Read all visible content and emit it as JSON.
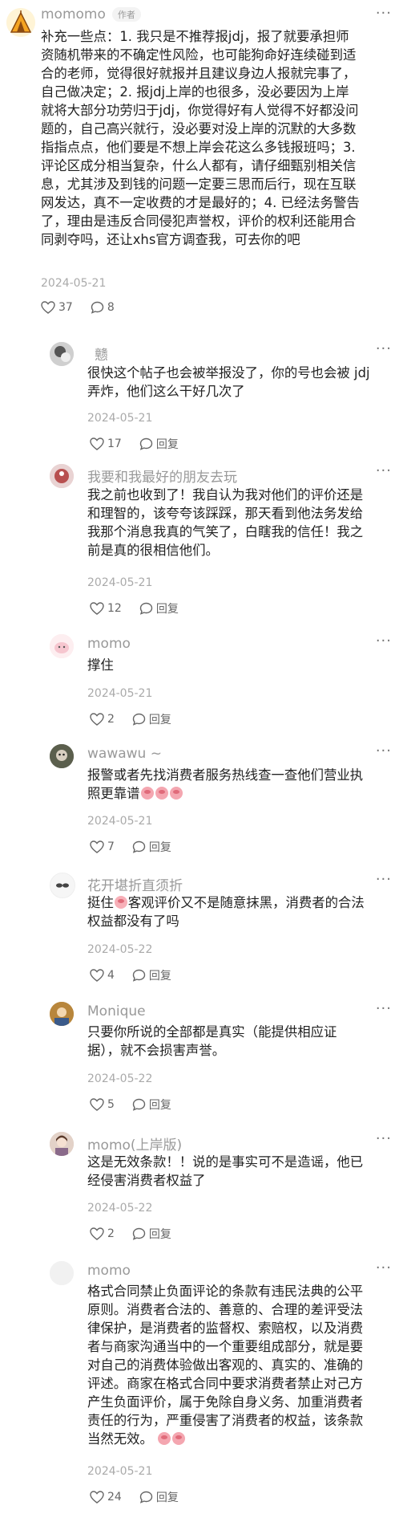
{
  "main_comment": {
    "author": "momomo",
    "author_tag": "作者",
    "lines": [
      "补充一些点：1. 我只是不推荐报jdj，报了就要承担师",
      "资随机带来的不确定性风险，也可能狗命好连续碰到适",
      "合的老师，觉得很好就报并且建议身边人报就完事了，",
      "自己做决定；2. 报jdj上岸的也很多，没必要因为上岸",
      "就将大部分功劳归于jdj，你觉得好有人觉得不好都没问",
      "题的，自己高兴就行，没必要对没上岸的沉默的大多数",
      "指指点点，他们要是不想上岸会花这么多钱报班吗；3.",
      "评论区成分相当复杂，什么人都有，请仔细甄别相关信",
      "息，尤其涉及到钱的问题一定要三思而后行，现在互联",
      "网发达，真不一定收费的才是最好的；4. 已经法务警告",
      "了，理由是违反合同侵犯声誉权，评价的权利还能用合",
      "同剥夺吗，还让xhs官方调查我，可去你的吧"
    ],
    "date": "2024-05-21",
    "likes": "37",
    "replies": "8"
  },
  "replies": [
    {
      "author": "戆",
      "lines": [
        "很快这个帖子也会被举报没了，你的号也会被 jdj",
        "弄炸，他们这么干好几次了"
      ],
      "date": "2024-05-21",
      "likes": "17",
      "reply_label": "回复"
    },
    {
      "author": "我要和我最好的朋友去玩",
      "lines": [
        "我之前也收到了！我自认为我对他们的评价还是",
        "和理智的，该夸夸该踩踩，那天看到他法务发给",
        "我那个消息我真的气笑了，白瞎我的信任！我之",
        "前是真的很相信他们。"
      ],
      "date": "2024-05-21",
      "likes": "12",
      "reply_label": "回复"
    },
    {
      "author": "momo",
      "lines": [
        "撑住"
      ],
      "date": "2024-05-21",
      "likes": "2",
      "reply_label": "回复"
    },
    {
      "author": "wawawu ~",
      "lines": [
        "报警或者先找消费者服务热线查一查他们营业执",
        "照更靠谱"
      ],
      "emoji_after_last": 3,
      "date": "2024-05-21",
      "likes": "7",
      "reply_label": "回复"
    },
    {
      "author": "花开堪折直须折",
      "lines": [
        "挺住",
        "客观评价又不是随意抹黑，消费者的合法",
        "权益都没有了吗"
      ],
      "date": "2024-05-22",
      "likes": "4",
      "reply_label": "回复"
    },
    {
      "author": "Monique",
      "lines": [
        "只要你所说的全部都是真实（能提供相应证",
        "据），就不会损害声誉。"
      ],
      "date": "2024-05-22",
      "likes": "5",
      "reply_label": "回复"
    },
    {
      "author": "momo(上岸版)",
      "lines": [
        "这是无效条款！！说的是事实可不是造谣，他已",
        "经侵害消费者权益了"
      ],
      "date": "2024-05-22",
      "likes": "2",
      "reply_label": "回复"
    },
    {
      "author": "momo",
      "lines": [
        "格式合同禁止负面评论的条款有违民法典的公平",
        "原则。消费者合法的、善意的、合理的差评受法",
        "律保护，是消费者的监督权、索赔权，以及消费",
        "者与商家沟通当中的一个重要组成部分，就是要",
        "对自己的消费体验做出客观的、真实的、准确的",
        "评述。商家在格式合同中要求消费者禁止对己方",
        "产生负面评价，属于免除自身义务、加重消费者",
        "责任的行为，严重侵害了消费者的权益，该条款",
        "当然无效。"
      ],
      "emoji_after_last": 2,
      "date": "2024-05-21",
      "likes": "24",
      "reply_label": "回复"
    }
  ],
  "more_label": "···",
  "colors": {
    "text": "#222222",
    "meta": "#aaaaaa",
    "name": "#999999"
  }
}
